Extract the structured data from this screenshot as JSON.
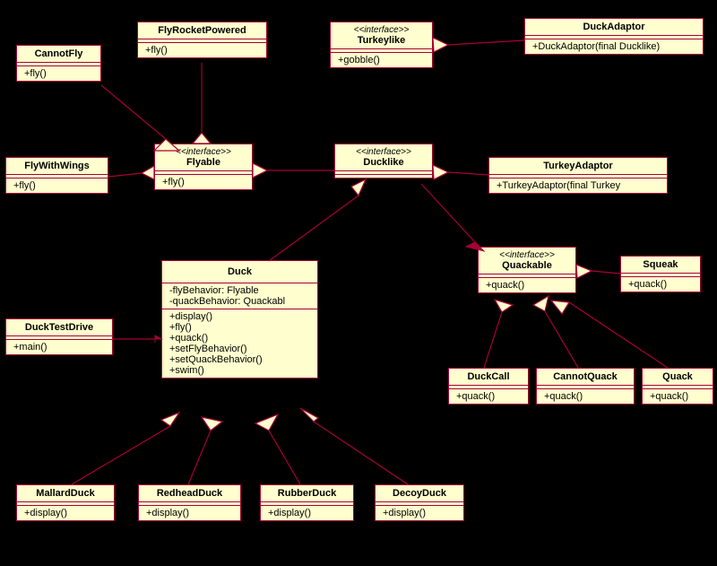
{
  "classes": {
    "CannotFly": {
      "name": "CannotFly",
      "methods": "+fly()"
    },
    "FlyRocketPowered": {
      "name": "FlyRocketPowered",
      "methods": "+fly()"
    },
    "FlyWithWings": {
      "name": "FlyWithWings",
      "methods": "+fly()"
    },
    "Flyable": {
      "stereotype": "<<interface>>",
      "name": "Flyable",
      "methods": "+fly()"
    },
    "Turkeylike": {
      "stereotype": "<<interface>>",
      "name": "Turkeylike",
      "methods": "+gobble()"
    },
    "DuckAdaptor": {
      "name": "DuckAdaptor",
      "methods": "+DuckAdaptor(final Ducklike)"
    },
    "Ducklike": {
      "stereotype": "<<interface>>",
      "name": "Ducklike"
    },
    "TurkeyAdaptor": {
      "name": "TurkeyAdaptor",
      "methods": "+TurkeyAdaptor(final Turkey"
    },
    "Duck": {
      "name": "Duck",
      "attrs": "-flyBehavior: Flyable\n-quackBehavior: Quackabl",
      "methods": "+display()\n+fly()\n+quack()\n+setFlyBehavior()\n+setQuackBehavior()\n+swim()"
    },
    "DuckTestDrive": {
      "name": "DuckTestDrive",
      "methods": "+main()"
    },
    "Quackable": {
      "stereotype": "<<interface>>",
      "name": "Quackable",
      "methods": "+quack()"
    },
    "Squeak": {
      "name": "Squeak",
      "methods": "+quack()"
    },
    "DuckCall": {
      "name": "DuckCall",
      "methods": "+quack()"
    },
    "CannotQuack": {
      "name": "CannotQuack",
      "methods": "+quack()"
    },
    "Quack": {
      "name": "Quack",
      "methods": "+quack()"
    },
    "MallardDuck": {
      "name": "MallardDuck",
      "methods": "+display()"
    },
    "RedheadDuck": {
      "name": "RedheadDuck",
      "methods": "+display()"
    },
    "RubberDuck": {
      "name": "RubberDuck",
      "methods": "+display()"
    },
    "DecoyDuck": {
      "name": "DecoyDuck",
      "methods": "+display()"
    }
  }
}
